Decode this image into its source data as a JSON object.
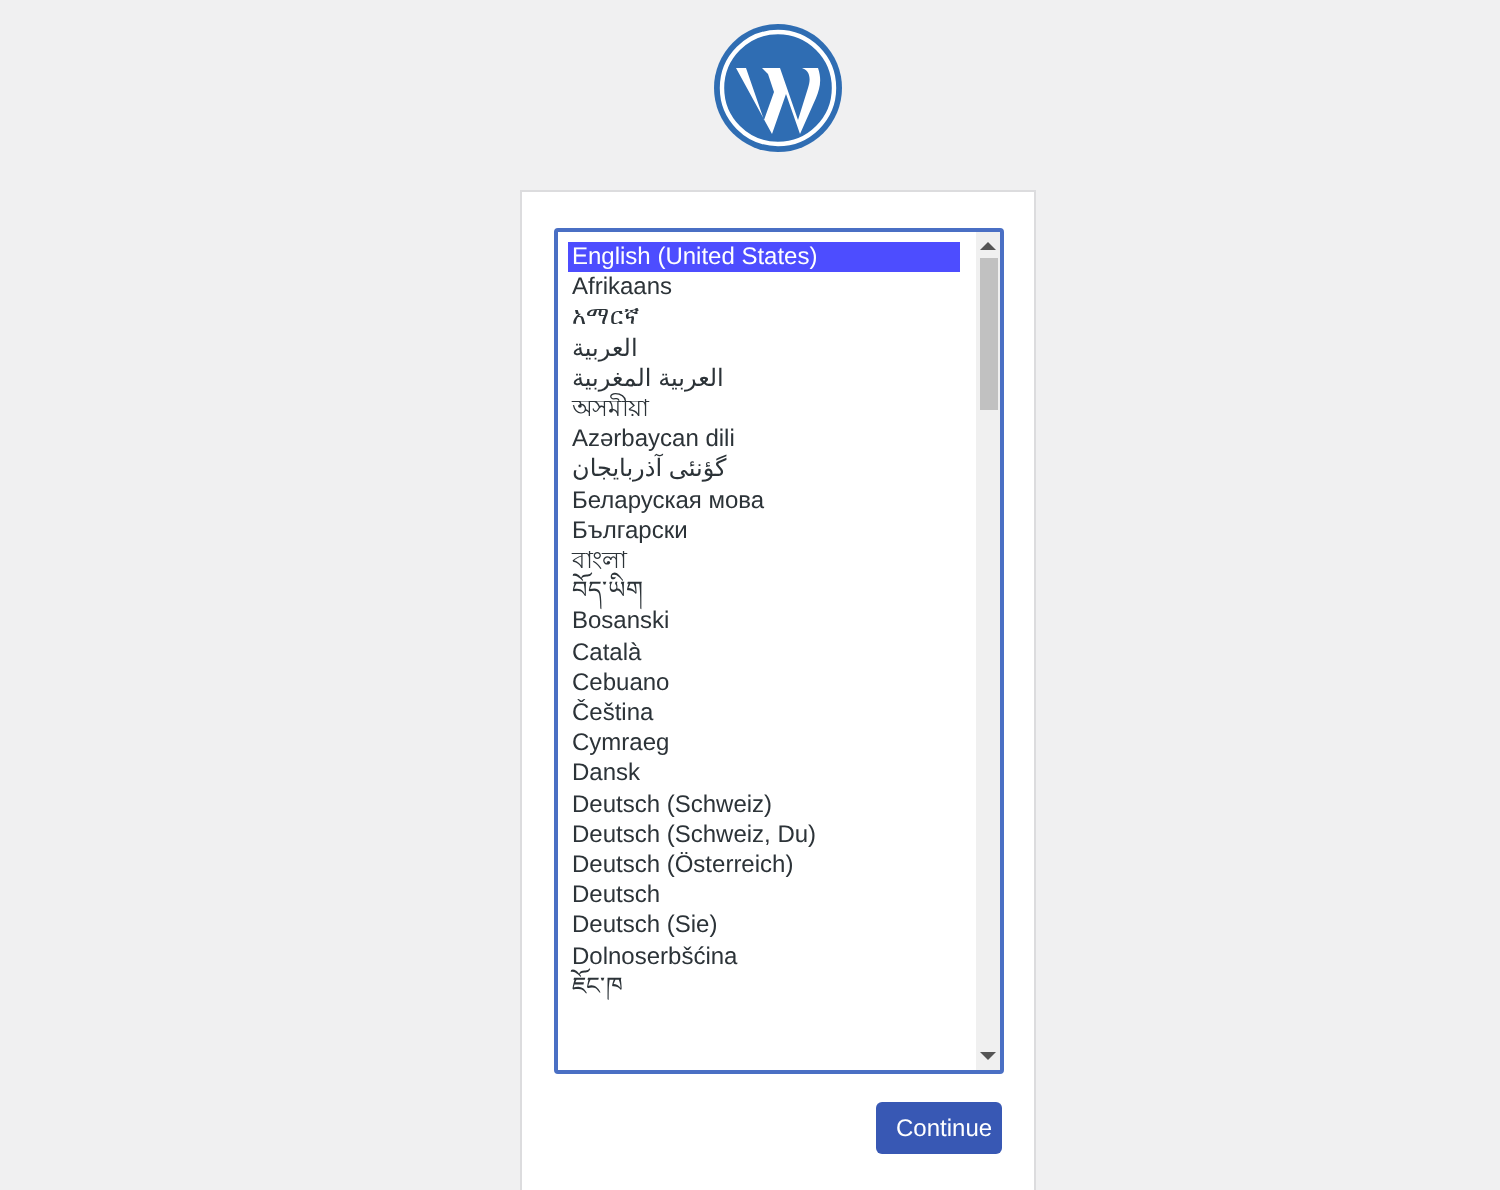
{
  "language_list": [
    {
      "label": "English (United States)",
      "selected": true
    },
    {
      "label": "Afrikaans",
      "selected": false
    },
    {
      "label": "አማርኛ",
      "selected": false
    },
    {
      "label": "العربية",
      "selected": false
    },
    {
      "label": "العربية المغربية",
      "selected": false
    },
    {
      "label": "অসমীয়া",
      "selected": false
    },
    {
      "label": "Azərbaycan dili",
      "selected": false
    },
    {
      "label": "گؤنئی آذربایجان",
      "selected": false
    },
    {
      "label": "Беларуская мова",
      "selected": false
    },
    {
      "label": "Български",
      "selected": false
    },
    {
      "label": "বাংলা",
      "selected": false
    },
    {
      "label": "བོད་ཡིག",
      "selected": false
    },
    {
      "label": "Bosanski",
      "selected": false
    },
    {
      "label": "Català",
      "selected": false
    },
    {
      "label": "Cebuano",
      "selected": false
    },
    {
      "label": "Čeština",
      "selected": false
    },
    {
      "label": "Cymraeg",
      "selected": false
    },
    {
      "label": "Dansk",
      "selected": false
    },
    {
      "label": "Deutsch (Schweiz)",
      "selected": false
    },
    {
      "label": "Deutsch (Schweiz, Du)",
      "selected": false
    },
    {
      "label": "Deutsch (Österreich)",
      "selected": false
    },
    {
      "label": "Deutsch",
      "selected": false
    },
    {
      "label": "Deutsch (Sie)",
      "selected": false
    },
    {
      "label": "Dolnoserbšćina",
      "selected": false
    },
    {
      "label": "ཇོང་ཁ",
      "selected": false
    }
  ],
  "continue_button": "Continue"
}
